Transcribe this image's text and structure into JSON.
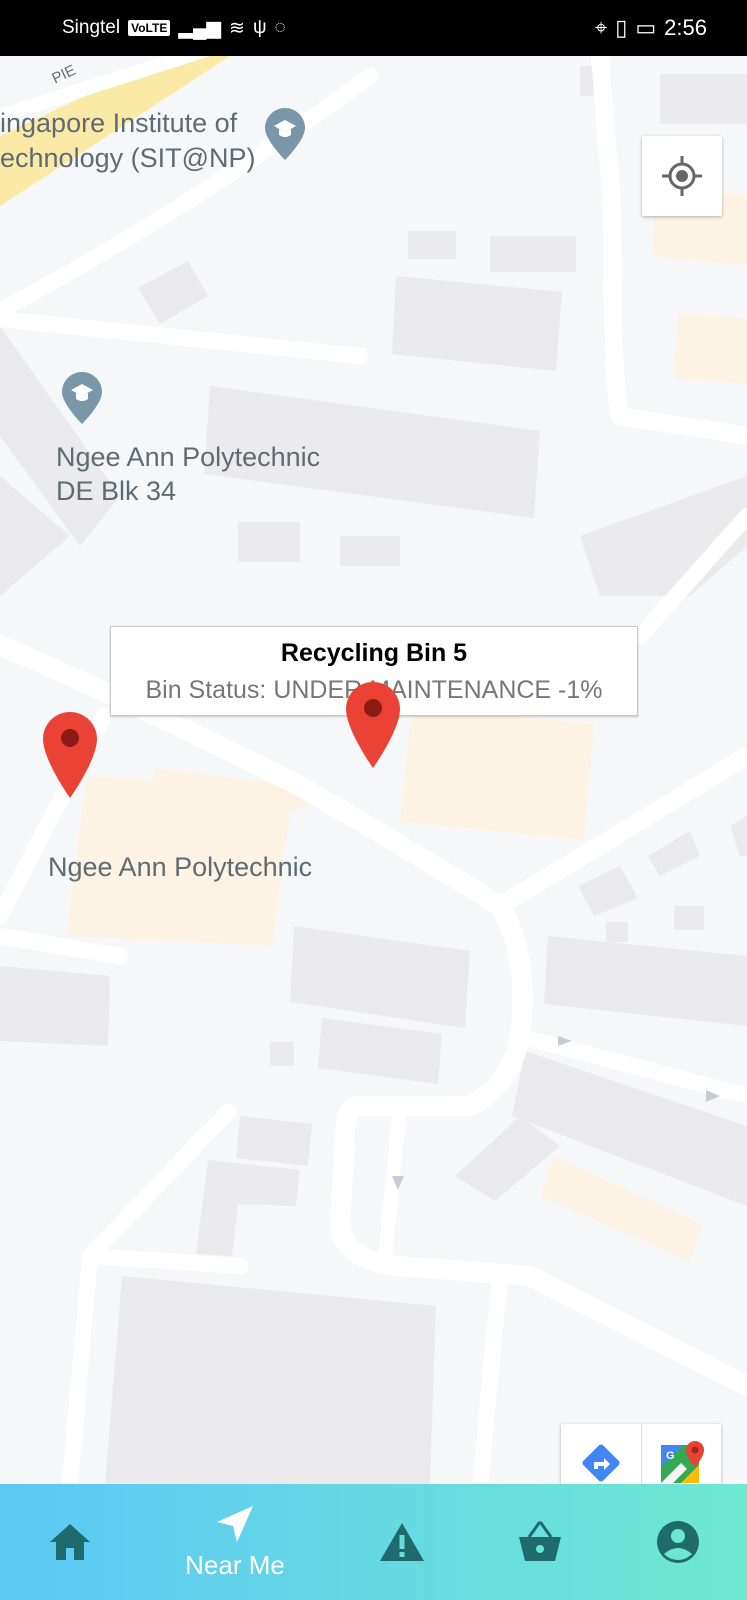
{
  "status_bar": {
    "carrier": "Singtel",
    "volte": "VoLTE",
    "time": "2:56"
  },
  "map": {
    "labels": {
      "sit": "ingapore Institute of",
      "sit2": "echnology (SIT@NP)",
      "np_de": "Ngee Ann Polytechnic",
      "np_de2": "DE Blk 34",
      "np": "Ngee Ann Polytechnic",
      "road": "PIE"
    },
    "info_window": {
      "title": "Recycling Bin 5",
      "status": "Bin Status: UNDER MAINTENANCE -1%"
    },
    "attribution": "Google"
  },
  "bottom_nav": {
    "items": [
      {
        "icon": "home-icon",
        "label": ""
      },
      {
        "icon": "navigation-icon",
        "label": "Near Me"
      },
      {
        "icon": "warning-icon",
        "label": ""
      },
      {
        "icon": "basket-icon",
        "label": ""
      },
      {
        "icon": "account-icon",
        "label": ""
      }
    ],
    "active_index": 1
  },
  "colors": {
    "marker": "#ea4335",
    "nav_gradient_start": "#5cc8f5",
    "nav_gradient_end": "#6fe8d2",
    "nav_icon": "#1f6a6c"
  }
}
